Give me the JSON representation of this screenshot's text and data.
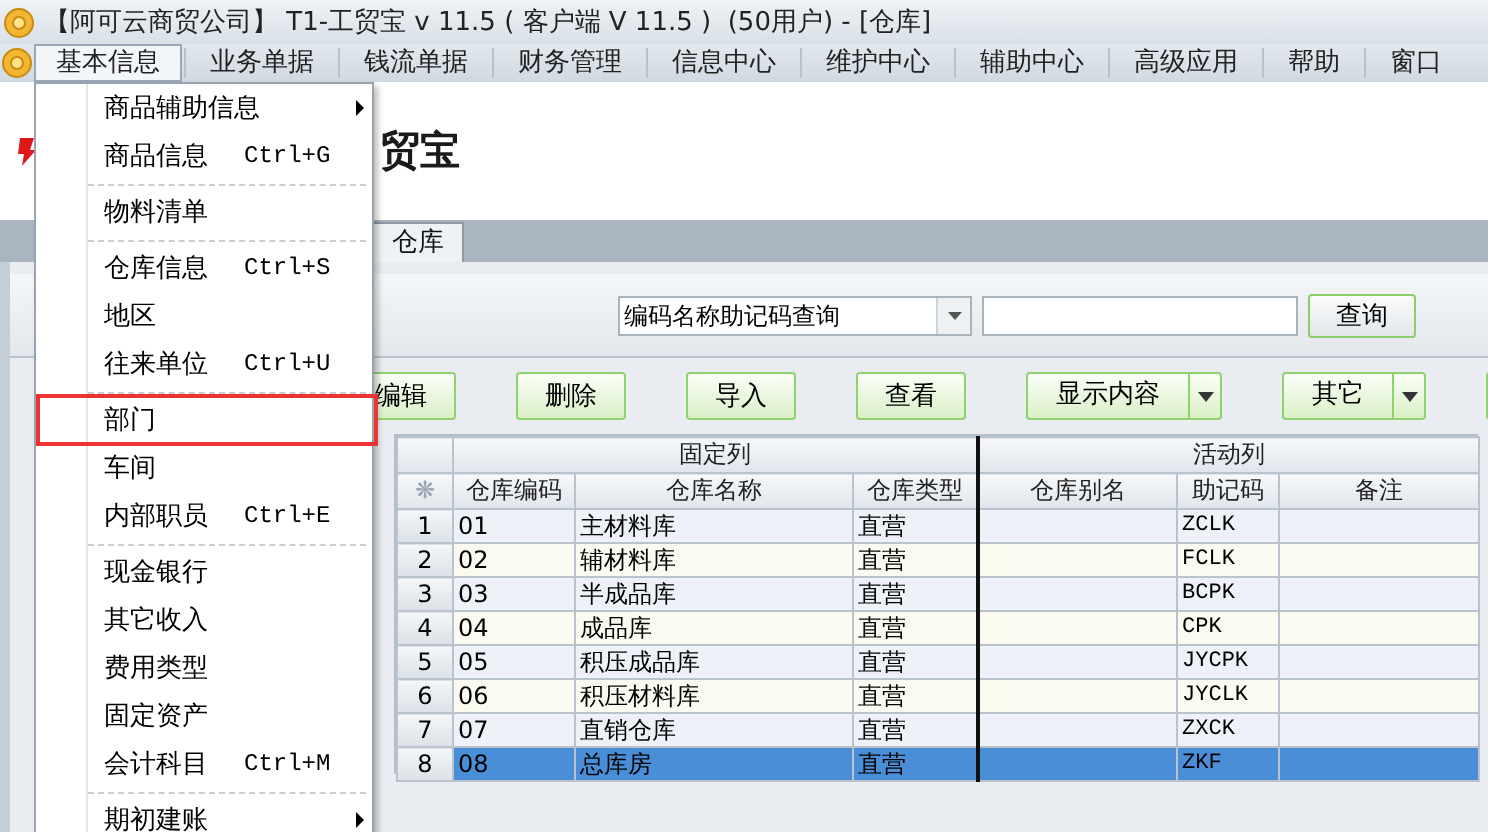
{
  "window": {
    "title": "【阿可云商贸公司】 T1-工贸宝 v 11.5 ( 客户端 V 11.5 )  (50用户) - [仓库]"
  },
  "menu_bar": [
    {
      "label": "基本信息",
      "selected": true
    },
    {
      "label": "业务单据",
      "selected": false
    },
    {
      "label": "钱流单据",
      "selected": false
    },
    {
      "label": "财务管理",
      "selected": false
    },
    {
      "label": "信息中心",
      "selected": false
    },
    {
      "label": "维护中心",
      "selected": false
    },
    {
      "label": "辅助中心",
      "selected": false
    },
    {
      "label": "高级应用",
      "selected": false
    },
    {
      "label": "帮助",
      "selected": false
    },
    {
      "label": "窗口",
      "selected": false
    }
  ],
  "dropdown_menu": {
    "items": [
      {
        "kind": "item",
        "label": "商品辅助信息",
        "has_submenu": true,
        "highlighted": false
      },
      {
        "kind": "item",
        "label": "商品信息",
        "shortcut": "Ctrl+G",
        "has_submenu": false,
        "highlighted": false
      },
      {
        "kind": "separator"
      },
      {
        "kind": "item",
        "label": "物料清单",
        "has_submenu": false,
        "highlighted": false
      },
      {
        "kind": "separator"
      },
      {
        "kind": "item",
        "label": "仓库信息",
        "shortcut": "Ctrl+S",
        "has_submenu": false,
        "highlighted": false
      },
      {
        "kind": "item",
        "label": "地区",
        "has_submenu": false,
        "highlighted": false
      },
      {
        "kind": "item",
        "label": "往来单位",
        "shortcut": "Ctrl+U",
        "has_submenu": false,
        "highlighted": false
      },
      {
        "kind": "separator"
      },
      {
        "kind": "item",
        "label": "部门",
        "has_submenu": false,
        "highlighted": true
      },
      {
        "kind": "item",
        "label": "车间",
        "has_submenu": false,
        "highlighted": false
      },
      {
        "kind": "item",
        "label": "内部职员",
        "shortcut": "Ctrl+E",
        "has_submenu": false,
        "highlighted": false
      },
      {
        "kind": "separator"
      },
      {
        "kind": "item",
        "label": "现金银行",
        "has_submenu": false,
        "highlighted": false
      },
      {
        "kind": "item",
        "label": "其它收入",
        "has_submenu": false,
        "highlighted": false
      },
      {
        "kind": "item",
        "label": "费用类型",
        "has_submenu": false,
        "highlighted": false
      },
      {
        "kind": "item",
        "label": "固定资产",
        "has_submenu": false,
        "highlighted": false
      },
      {
        "kind": "item",
        "label": "会计科目",
        "shortcut": "Ctrl+M",
        "has_submenu": false,
        "highlighted": false
      },
      {
        "kind": "separator"
      },
      {
        "kind": "item",
        "label": "期初建账",
        "has_submenu": true,
        "highlighted": false
      }
    ]
  },
  "logo": {
    "text": "贸宝"
  },
  "tabs": [
    {
      "label": "仓库",
      "selected": true
    }
  ],
  "search": {
    "mode": "编码名称助记码查询",
    "button": "查询"
  },
  "toolbar": [
    {
      "kind": "button",
      "label": "编辑"
    },
    {
      "kind": "button",
      "label": "删除"
    },
    {
      "kind": "button",
      "label": "导入"
    },
    {
      "kind": "button",
      "label": "查看"
    },
    {
      "kind": "split",
      "label": "显示内容"
    },
    {
      "kind": "split",
      "label": "其它"
    },
    {
      "kind": "button"
    }
  ],
  "table": {
    "corner_mark": "❋",
    "groups": [
      {
        "label": "固定列"
      },
      {
        "label": "活动列"
      }
    ],
    "columns": [
      "仓库编码",
      "仓库名称",
      "仓库类型",
      "仓库别名",
      "助记码",
      "备注"
    ],
    "rows": [
      {
        "number": "1",
        "code": "01",
        "name": "主材料库",
        "type": "直营",
        "mnemonic": "ZCLK",
        "selected": false
      },
      {
        "number": "2",
        "code": "02",
        "name": "辅材料库",
        "type": "直营",
        "mnemonic": "FCLK",
        "selected": false
      },
      {
        "number": "3",
        "code": "03",
        "name": "半成品库",
        "type": "直营",
        "mnemonic": "BCPK",
        "selected": false
      },
      {
        "number": "4",
        "code": "04",
        "name": "成品库",
        "type": "直营",
        "mnemonic": "CPK",
        "selected": false
      },
      {
        "number": "5",
        "code": "05",
        "name": "积压成品库",
        "type": "直营",
        "mnemonic": "JYCPK",
        "selected": false
      },
      {
        "number": "6",
        "code": "06",
        "name": "积压材料库",
        "type": "直营",
        "mnemonic": "JYCLK",
        "selected": false
      },
      {
        "number": "7",
        "code": "07",
        "name": "直销仓库",
        "type": "直营",
        "mnemonic": "ZXCK",
        "selected": false
      },
      {
        "number": "8",
        "code": "08",
        "name": "总库房",
        "type": "直营",
        "mnemonic": "ZKF",
        "selected": true
      }
    ]
  }
}
